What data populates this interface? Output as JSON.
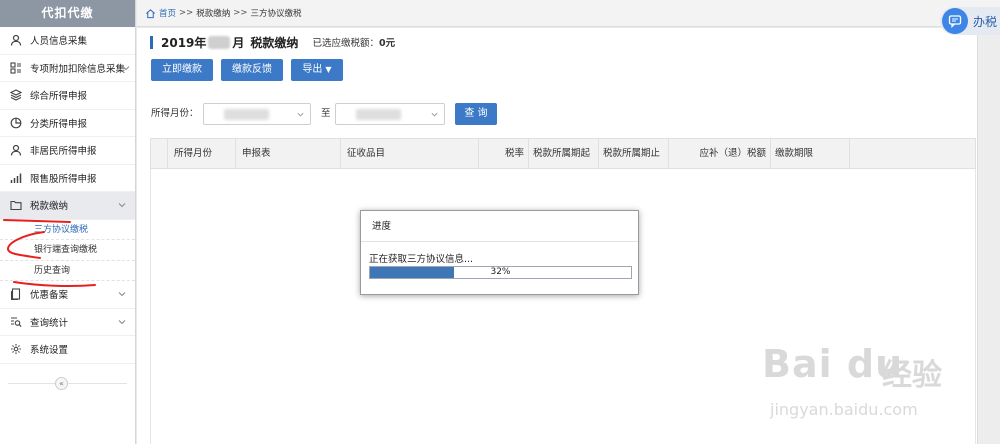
{
  "sidebar": {
    "logo": "代扣代缴",
    "items": [
      {
        "label": "人员信息采集",
        "icon": "person-icon"
      },
      {
        "label": "专项附加扣除信息采集",
        "icon": "list-icon",
        "has_children": true
      },
      {
        "label": "综合所得申报",
        "icon": "layers-icon"
      },
      {
        "label": "分类所得申报",
        "icon": "pie-chart-icon"
      },
      {
        "label": "非居民所得申报",
        "icon": "person-icon"
      },
      {
        "label": "限售股所得申报",
        "icon": "bar-chart-icon"
      },
      {
        "label": "税款缴纳",
        "icon": "folder-icon",
        "has_children": true,
        "expanded": true
      }
    ],
    "sub_items": [
      {
        "label": "三方协议缴税",
        "current": true
      },
      {
        "label": "银行端查询缴税"
      },
      {
        "label": "历史查询"
      }
    ],
    "items_after": [
      {
        "label": "优惠备案",
        "icon": "document-icon",
        "has_children": true
      },
      {
        "label": "查询统计",
        "icon": "search-list-icon",
        "has_children": true
      },
      {
        "label": "系统设置",
        "icon": "gear-icon"
      }
    ],
    "collapse_glyph": "«"
  },
  "breadcrumb": {
    "home": "首页",
    "separator": ">>",
    "level1": "税款缴纳",
    "level2": "三方协议缴税"
  },
  "office_button": {
    "label": "办税"
  },
  "page": {
    "title_year": "2019年",
    "title_month_suffix": "月",
    "title_name": "税款缴纳",
    "selected_label": "已选应缴税额：",
    "selected_value": "0元"
  },
  "toolbar": {
    "pay_now": "立即缴款",
    "feedback": "缴款反馈",
    "export": "导出",
    "export_arrow": "▼"
  },
  "filter": {
    "month_label": "所得月份：",
    "to_label": "至",
    "query_button": "查 询"
  },
  "table": {
    "columns": [
      "所得月份",
      "申报表",
      "征收品目",
      "税率",
      "税款所属期起",
      "税款所属期止",
      "应补（退）税额",
      "缴款期限"
    ]
  },
  "dialog": {
    "title": "进度",
    "message": "正在获取三方协议信息...",
    "progress": 0.32,
    "progress_label": "32%"
  },
  "watermark": {
    "brand": "Bai du",
    "brand_cn": "经验",
    "url": "jingyan.baidu.com"
  },
  "colors": {
    "accent": "#3c79c7",
    "progress": "#3f77b6",
    "annotation": "#e8201e",
    "logo_bg": "#8d96a3"
  }
}
